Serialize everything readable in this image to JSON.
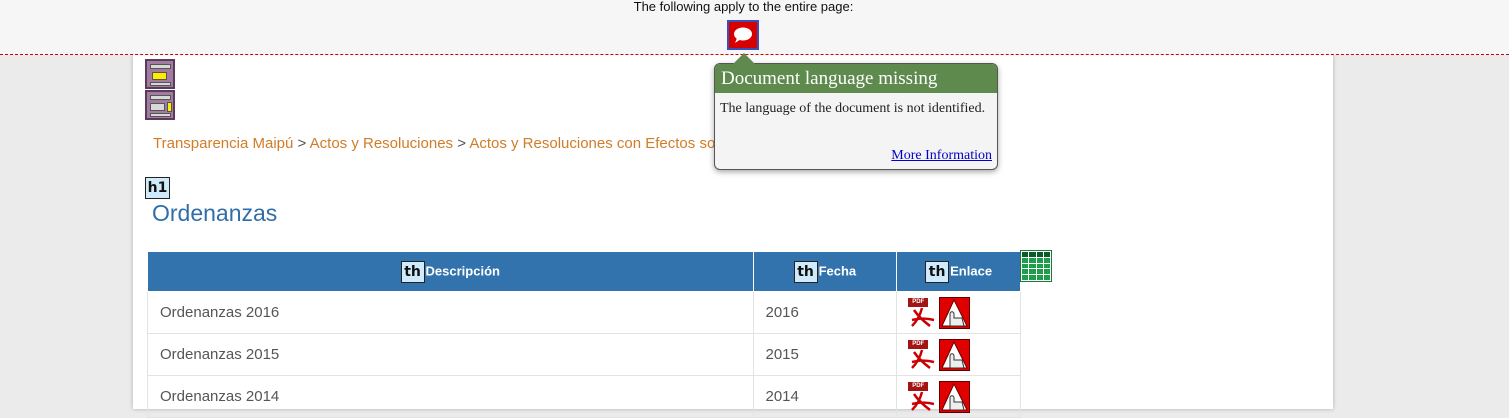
{
  "wave": {
    "banner_text": "The following apply to the entire page:",
    "tooltip": {
      "title": "Document language missing",
      "body": "The language of the document is not identified.",
      "link": "More Information"
    }
  },
  "breadcrumb": {
    "items": [
      "Transparencia Maipú",
      "Actos y Resoluciones",
      "Actos y Resoluciones con Efectos so"
    ],
    "separator": ">"
  },
  "tags": {
    "h1": "h1",
    "th": "th"
  },
  "page": {
    "title": "Ordenanzas"
  },
  "table": {
    "headers": [
      "Descripción",
      "Fecha",
      "Enlace"
    ],
    "rows": [
      {
        "descripcion": "Ordenanzas 2016",
        "fecha": "2016"
      },
      {
        "descripcion": "Ordenanzas 2015",
        "fecha": "2015"
      },
      {
        "descripcion": "Ordenanzas 2014",
        "fecha": "2014"
      }
    ],
    "pdf_label": "PDF"
  },
  "colors": {
    "accent": "#3273ae",
    "link": "#d27b28",
    "title": "#2f6eab",
    "error": "#d60000",
    "tooltip_header": "#5e8a4e"
  },
  "icons": [
    "wave-error-icon",
    "region-icon",
    "h1-icon",
    "th-icon",
    "pdf-icon",
    "acrobat-icon",
    "table-icon"
  ]
}
